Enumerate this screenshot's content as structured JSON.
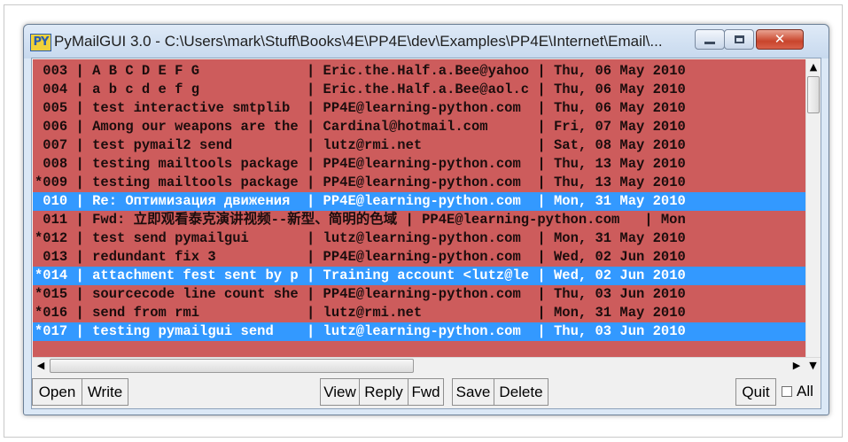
{
  "window": {
    "app_icon": "PY",
    "title": "PyMailGUI 3.0 - C:\\Users\\mark\\Stuff\\Books\\4E\\PP4E\\dev\\Examples\\PP4E\\Internet\\Email\\..."
  },
  "colors": {
    "row_background": "#cd5c5c",
    "selected_background": "#3399ff",
    "selected_text": "#ffffff"
  },
  "messages": [
    {
      "text": " 003 | A B C D E F G             | Eric.the.Half.a.Bee@yahoo | Thu, 06 May 2010 ",
      "selected": false
    },
    {
      "text": " 004 | a b c d e f g             | Eric.the.Half.a.Bee@aol.c | Thu, 06 May 2010 ",
      "selected": false
    },
    {
      "text": " 005 | test interactive smtplib  | PP4E@learning-python.com  | Thu, 06 May 2010 ",
      "selected": false
    },
    {
      "text": " 006 | Among our weapons are the | Cardinal@hotmail.com      | Fri, 07 May 2010 ",
      "selected": false
    },
    {
      "text": " 007 | test pymail2 send         | lutz@rmi.net              | Sat, 08 May 2010 ",
      "selected": false
    },
    {
      "text": " 008 | testing mailtools package | PP4E@learning-python.com  | Thu, 13 May 2010 ",
      "selected": false
    },
    {
      "text": "*009 | testing mailtools package | PP4E@learning-python.com  | Thu, 13 May 2010 ",
      "selected": false
    },
    {
      "text": " 010 | Re: Оптимизация движения  | PP4E@learning-python.com  | Mon, 31 May 2010 ",
      "selected": true
    },
    {
      "text": " 011 | Fwd: 立即观看泰克演讲视频--新型、简明的色域 | PP4E@learning-python.com   | Mon",
      "selected": false
    },
    {
      "text": "*012 | test send pymailgui       | lutz@learning-python.com  | Mon, 31 May 2010 ",
      "selected": false
    },
    {
      "text": " 013 | redundant fix 3           | PP4E@learning-python.com  | Wed, 02 Jun 2010 ",
      "selected": false
    },
    {
      "text": "*014 | attachment fest sent by p | Training account <lutz@le | Wed, 02 Jun 2010 ",
      "selected": true
    },
    {
      "text": "*015 | sourcecode line count she | PP4E@learning-python.com  | Thu, 03 Jun 2010 ",
      "selected": false
    },
    {
      "text": "*016 | send from rmi             | lutz@rmi.net              | Mon, 31 May 2010 ",
      "selected": false
    },
    {
      "text": "*017 | testing pymailgui send    | lutz@learning-python.com  | Thu, 03 Jun 2010 ",
      "selected": true
    }
  ],
  "scroll_icons": {
    "up": "▲",
    "down": "▼",
    "left": "◀",
    "right": "▶"
  },
  "buttons": {
    "open": "Open",
    "write": "Write",
    "view": "View",
    "reply": "Reply",
    "fwd": "Fwd",
    "save": "Save",
    "delete": "Delete",
    "quit": "Quit"
  },
  "all_checkbox": {
    "label": "All",
    "checked": false
  }
}
